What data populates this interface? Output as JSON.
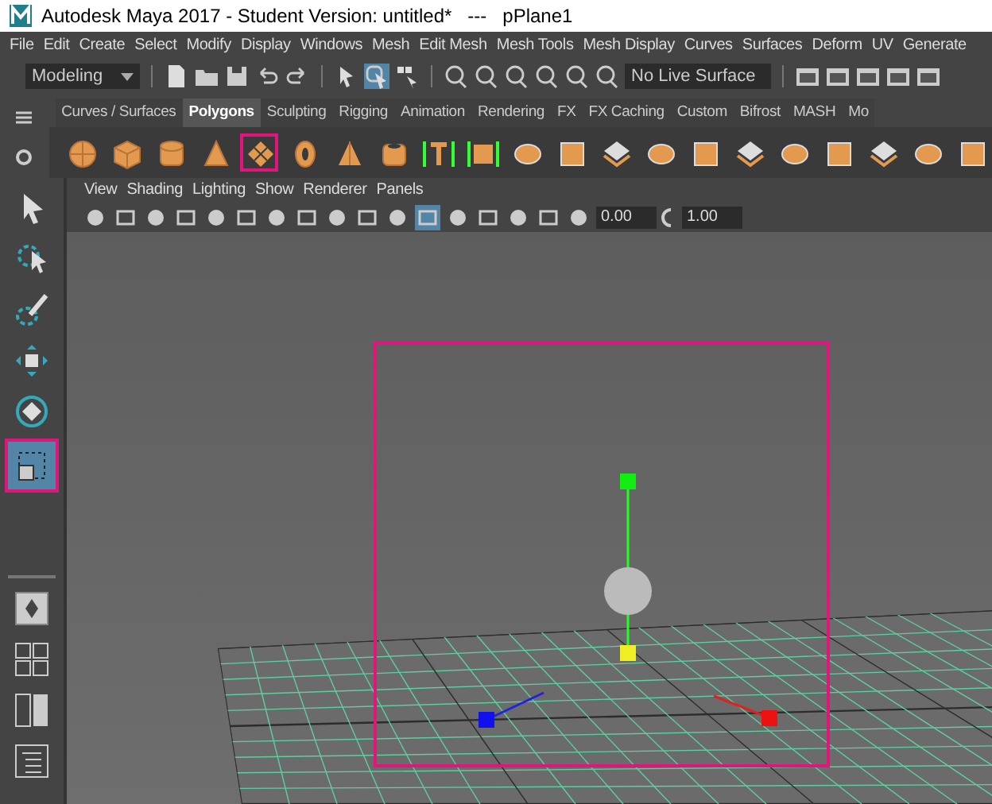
{
  "window": {
    "title": "Autodesk Maya 2017 - Student Version: untitled*   ---   pPlane1"
  },
  "menu": [
    "File",
    "Edit",
    "Create",
    "Select",
    "Modify",
    "Display",
    "Windows",
    "Mesh",
    "Edit Mesh",
    "Mesh Tools",
    "Mesh Display",
    "Curves",
    "Surfaces",
    "Deform",
    "UV",
    "Generate"
  ],
  "status_line": {
    "workspace": "Modeling",
    "live_surface": "No Live Surface",
    "selection_buttons": [
      {
        "selected": false
      },
      {
        "selected": true
      },
      {
        "selected": false
      }
    ]
  },
  "shelf_tabs": [
    {
      "label": "Curves / Surfaces",
      "selected": false
    },
    {
      "label": "Polygons",
      "selected": true
    },
    {
      "label": "Sculpting",
      "selected": false
    },
    {
      "label": "Rigging",
      "selected": false
    },
    {
      "label": "Animation",
      "selected": false
    },
    {
      "label": "Rendering",
      "selected": false
    },
    {
      "label": "FX",
      "selected": false
    },
    {
      "label": "FX Caching",
      "selected": false
    },
    {
      "label": "Custom",
      "selected": false
    },
    {
      "label": "Bifrost",
      "selected": false
    },
    {
      "label": "MASH",
      "selected": false
    },
    {
      "label": "Mo",
      "selected": false
    }
  ],
  "shelf_icons": [
    {
      "highlighted": false
    },
    {
      "highlighted": false
    },
    {
      "highlighted": false
    },
    {
      "highlighted": false
    },
    {
      "highlighted": true
    },
    {
      "highlighted": false
    },
    {
      "highlighted": false
    },
    {
      "highlighted": false
    }
  ],
  "tools": [
    {
      "selected": false,
      "highlighted": false
    },
    {
      "selected": false,
      "highlighted": false
    },
    {
      "selected": false,
      "highlighted": false
    },
    {
      "selected": false,
      "highlighted": false
    },
    {
      "selected": false,
      "highlighted": false
    },
    {
      "selected": true,
      "highlighted": true
    }
  ],
  "panel": {
    "menu": [
      "View",
      "Shading",
      "Lighting",
      "Show",
      "Renderer",
      "Panels"
    ],
    "field_1": "0.00",
    "field_2": "1.00"
  },
  "viewport": {
    "selection_highlighted": true
  }
}
